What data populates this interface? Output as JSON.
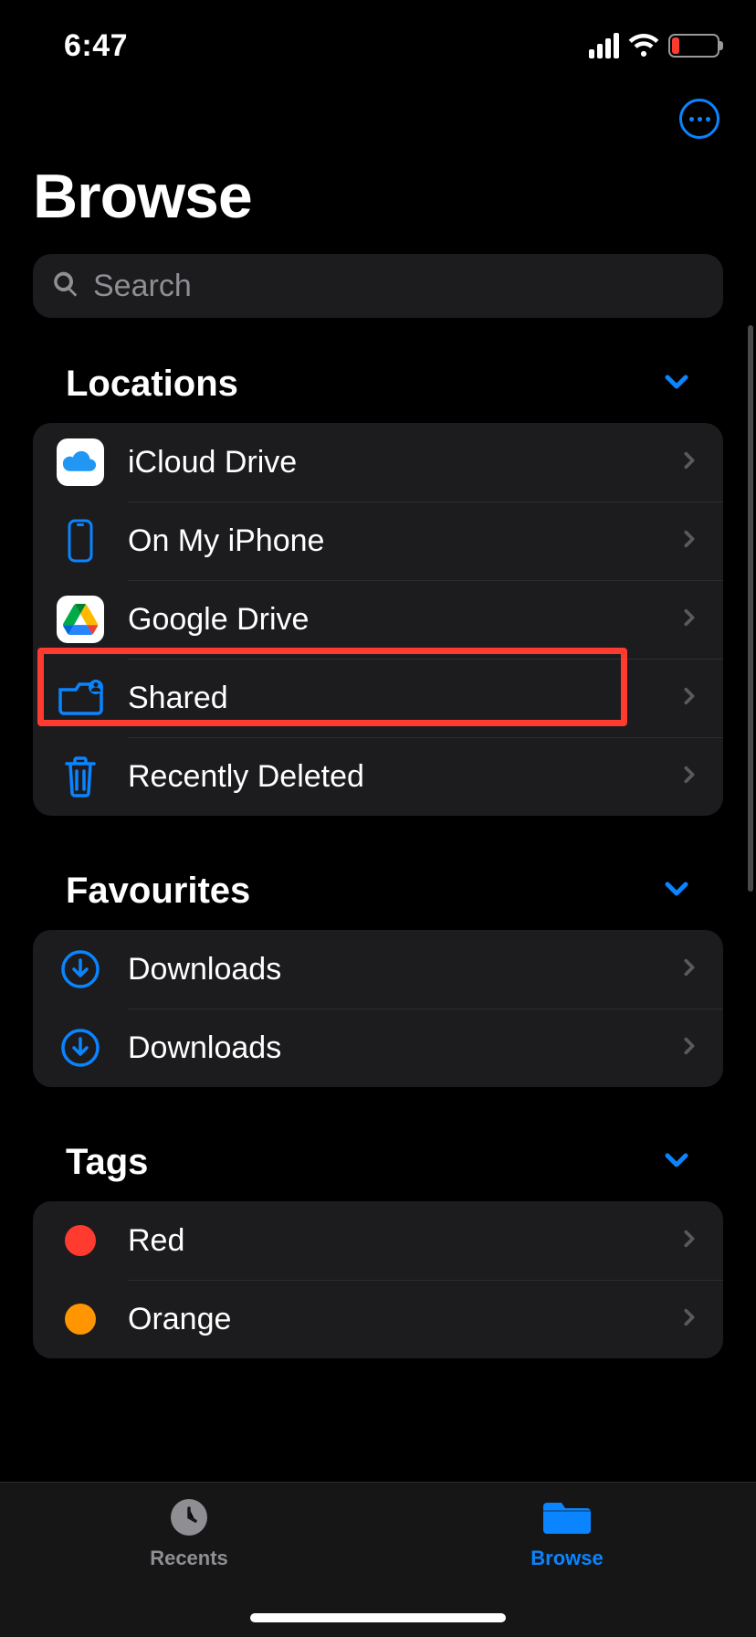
{
  "status": {
    "time": "6:47"
  },
  "header": {
    "title": "Browse"
  },
  "search": {
    "placeholder": "Search"
  },
  "sections": {
    "locations": {
      "title": "Locations",
      "items": [
        {
          "label": "iCloud Drive",
          "icon": "icloud-icon"
        },
        {
          "label": "On My iPhone",
          "icon": "iphone-icon"
        },
        {
          "label": "Google Drive",
          "icon": "google-drive-icon"
        },
        {
          "label": "Shared",
          "icon": "shared-folder-icon"
        },
        {
          "label": "Recently Deleted",
          "icon": "trash-icon"
        }
      ]
    },
    "favourites": {
      "title": "Favourites",
      "items": [
        {
          "label": "Downloads",
          "icon": "download-icon"
        },
        {
          "label": "Downloads",
          "icon": "download-icon"
        }
      ]
    },
    "tags": {
      "title": "Tags",
      "items": [
        {
          "label": "Red",
          "color": "#ff3b30"
        },
        {
          "label": "Orange",
          "color": "#ff9500"
        }
      ]
    }
  },
  "tabbar": {
    "recents": "Recents",
    "browse": "Browse"
  },
  "colors": {
    "accent": "#0a84ff"
  },
  "highlighted_item": "Google Drive"
}
